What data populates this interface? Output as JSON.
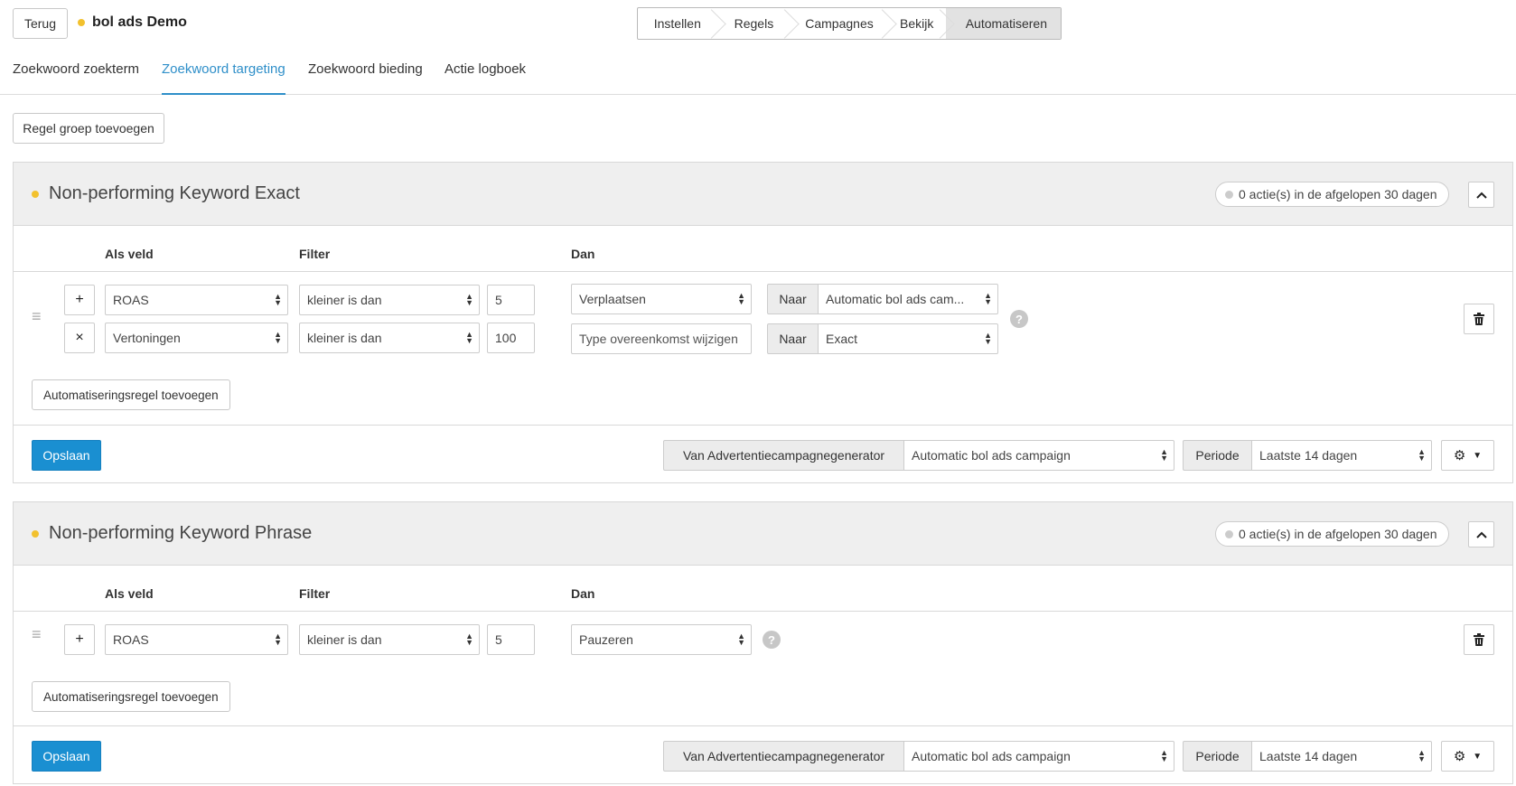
{
  "header": {
    "back_label": "Terug",
    "app_title": "bol ads Demo",
    "steps": [
      {
        "label": "Instellen"
      },
      {
        "label": "Regels"
      },
      {
        "label": "Campagnes"
      },
      {
        "label": "Bekijk"
      },
      {
        "label": "Automatiseren",
        "active": true
      }
    ]
  },
  "tabs": [
    {
      "label": "Zoekwoord zoekterm",
      "active": false
    },
    {
      "label": "Zoekwoord targeting",
      "active": true
    },
    {
      "label": "Zoekwoord bieding",
      "active": false
    },
    {
      "label": "Actie logboek",
      "active": false
    }
  ],
  "add_group_label": "Regel groep toevoegen",
  "colors": {
    "accent": "#2f8fc9",
    "status_dot": "#f2c12e",
    "save": "#1a8fd1"
  },
  "panels": [
    {
      "title": "Non-performing Keyword Exact",
      "actions_badge": "0 actie(s) in de afgelopen 30 dagen",
      "col_field": "Als veld",
      "col_filter": "Filter",
      "col_then": "Dan",
      "conditions": [
        {
          "toggle": "+",
          "field": "ROAS",
          "filter": "kleiner is dan",
          "value": "5"
        },
        {
          "toggle": "×",
          "field": "Vertoningen",
          "filter": "kleiner is dan",
          "value": "100"
        }
      ],
      "actions": [
        {
          "action": "Verplaatsen",
          "to_label": "Naar",
          "to_value": "Automatic bol ads cam..."
        },
        {
          "action_placeholder": "Type overeenkomst wijzigen",
          "to_label": "Naar",
          "to_value": "Exact"
        }
      ],
      "add_rule_label": "Automatiseringsregel toevoegen",
      "save_label": "Opslaan",
      "source_label": "Van Advertentiecampagnegenerator",
      "source_value": "Automatic bol ads campaign",
      "period_label": "Periode",
      "period_value": "Laatste 14 dagen"
    },
    {
      "title": "Non-performing Keyword Phrase",
      "actions_badge": "0 actie(s) in de afgelopen 30 dagen",
      "col_field": "Als veld",
      "col_filter": "Filter",
      "col_then": "Dan",
      "conditions": [
        {
          "toggle": "+",
          "field": "ROAS",
          "filter": "kleiner is dan",
          "value": "5"
        }
      ],
      "actions": [
        {
          "action": "Pauzeren"
        }
      ],
      "add_rule_label": "Automatiseringsregel toevoegen",
      "save_label": "Opslaan",
      "source_label": "Van Advertentiecampagnegenerator",
      "source_value": "Automatic bol ads campaign",
      "period_label": "Periode",
      "period_value": "Laatste 14 dagen"
    }
  ]
}
